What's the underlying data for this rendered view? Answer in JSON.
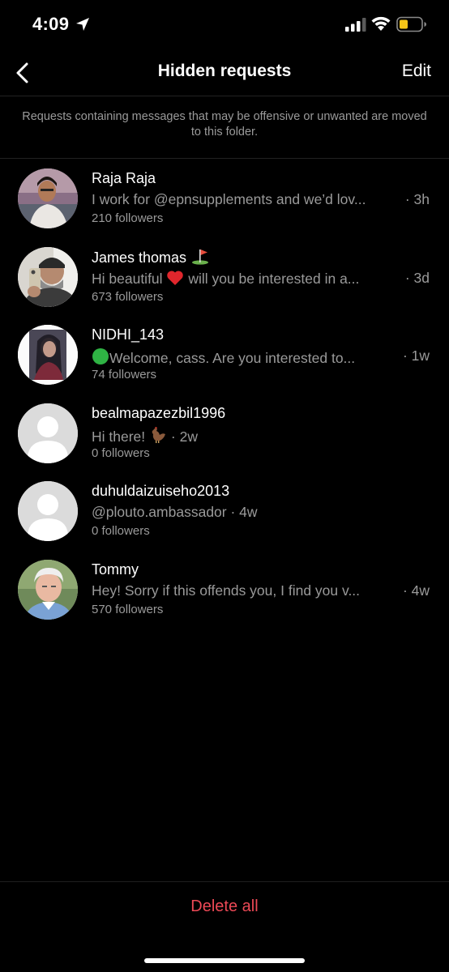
{
  "status_bar": {
    "time": "4:09",
    "battery_color": "#f5c518"
  },
  "nav": {
    "title": "Hidden requests",
    "edit_label": "Edit"
  },
  "notice": {
    "text": "Requests containing messages that may be offensive or unwanted are moved to this folder."
  },
  "requests": [
    {
      "name": "Raja Raja",
      "message": "I work for @epnsupplements and we’d lov...",
      "time": "· 3h",
      "followers": "210 followers",
      "avatar": "photo"
    },
    {
      "name": "James thomas",
      "name_icon": "golf-flag-icon",
      "message_before_icon": "Hi beautiful",
      "message_icon": "red-heart-icon",
      "message_after_icon": "will you be interested in a...",
      "time": "· 3d",
      "followers": "673 followers",
      "avatar": "photo"
    },
    {
      "name": "NIDHI_143",
      "message_icon": "green-circle-icon",
      "message": "Welcome, cass. Are you interested to...",
      "time": "· 1w",
      "followers": "74 followers",
      "avatar": "photo"
    },
    {
      "name": "bealmapazezbil1996",
      "message": "Hi there!",
      "message_icon": "rooster-icon",
      "time": "· 2w",
      "followers": "0 followers",
      "avatar": "default"
    },
    {
      "name": "duhuldaizuiseho2013",
      "message": "@plouto.ambassador",
      "time": "· 4w",
      "followers": "0 followers",
      "avatar": "default"
    },
    {
      "name": "Tommy",
      "message": "Hey! Sorry if this offends you, I find you v...",
      "time": "· 4w",
      "followers": "570 followers",
      "avatar": "photo"
    }
  ],
  "footer": {
    "delete_all_label": "Delete all",
    "accent_color": "#ed4956"
  }
}
